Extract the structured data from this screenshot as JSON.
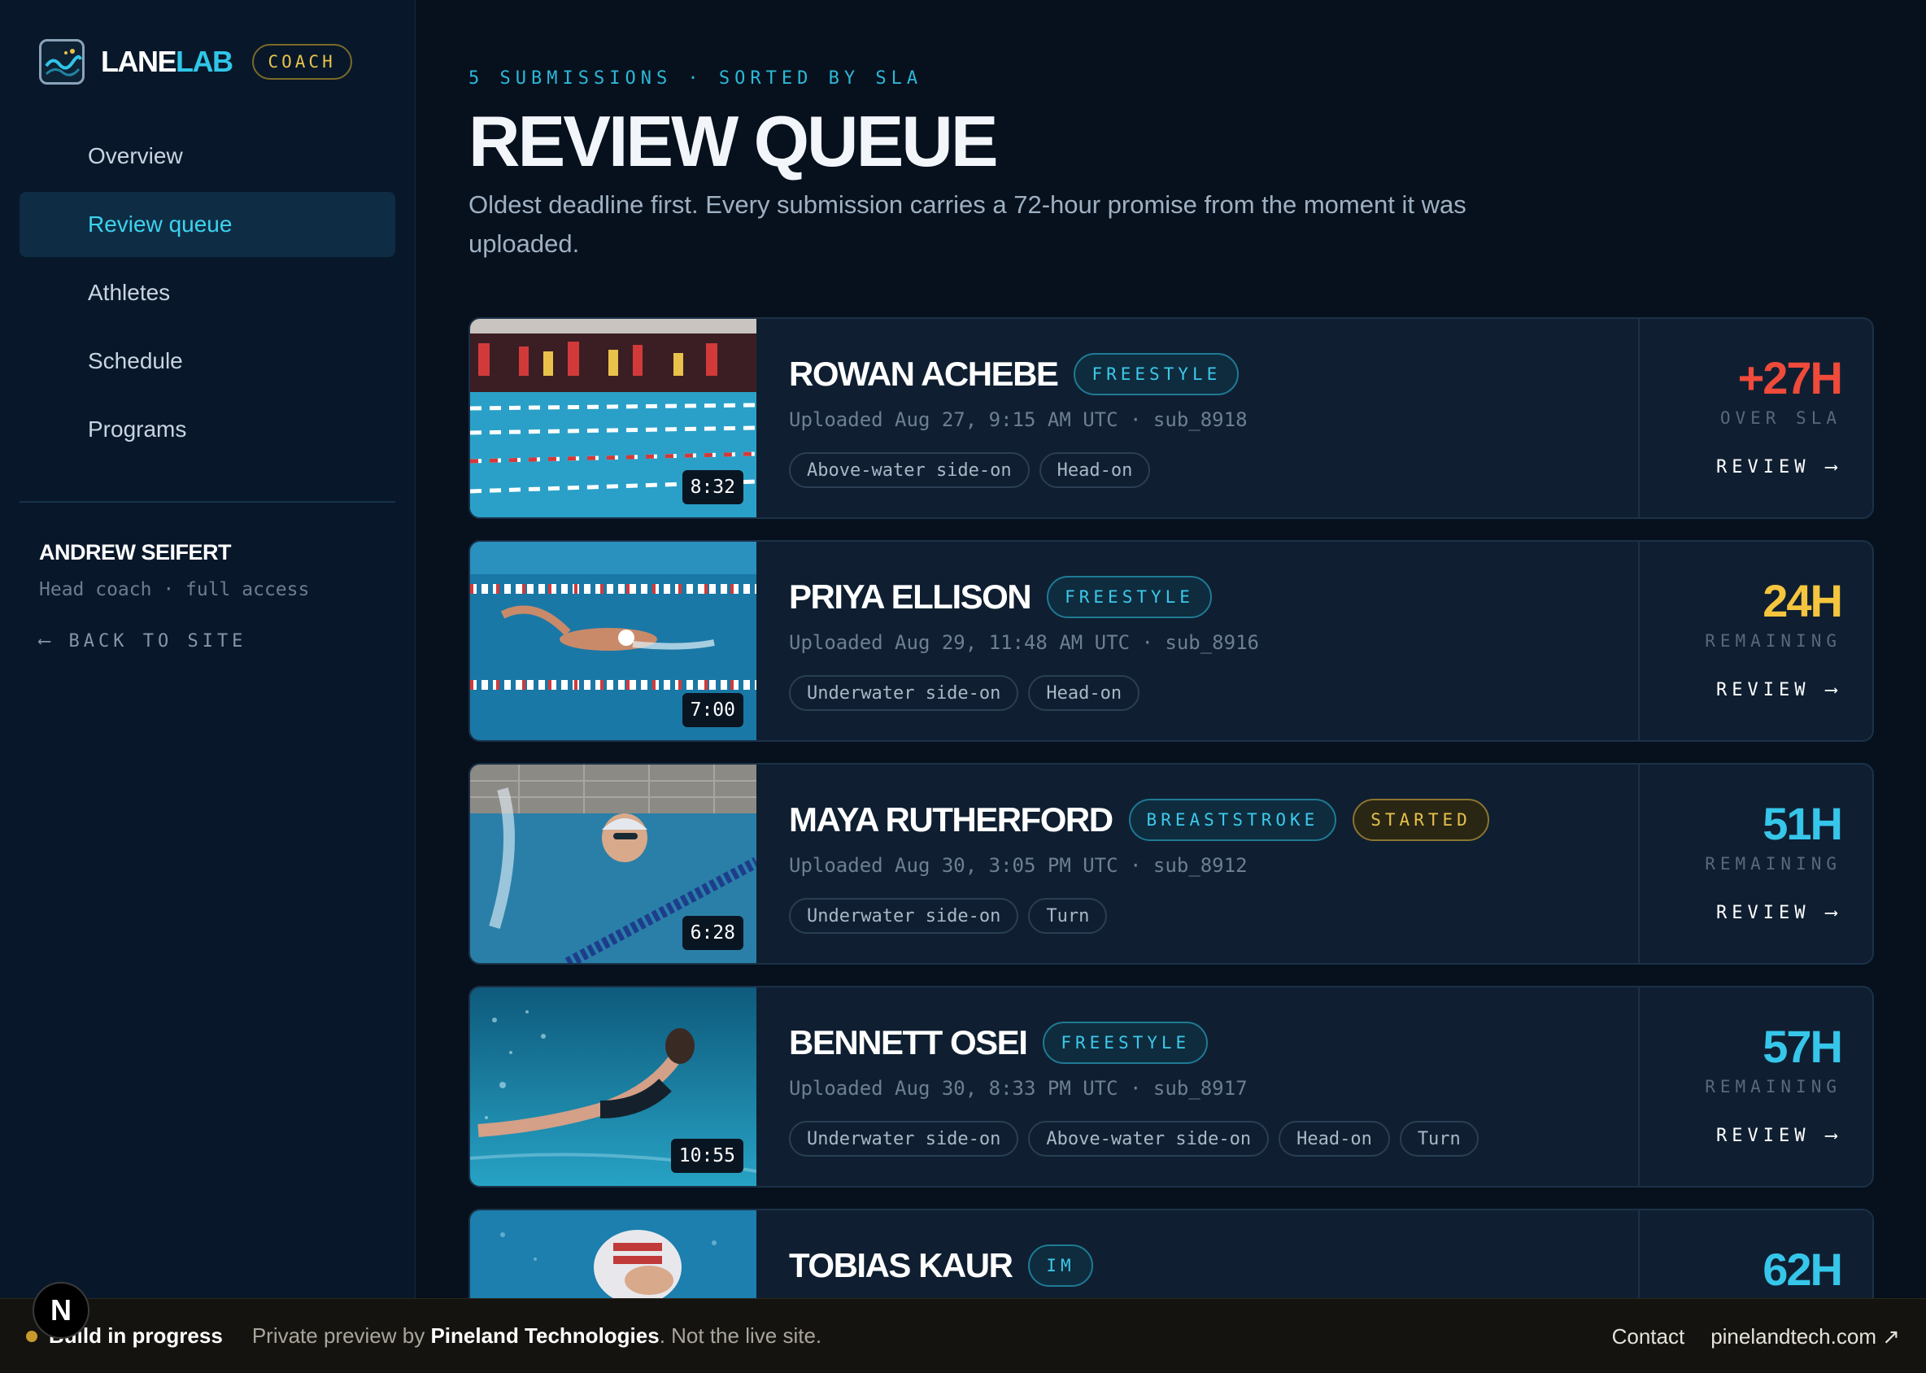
{
  "brand": {
    "name_part1": "LANE",
    "name_part2": "LAB",
    "role_badge": "COACH"
  },
  "nav": [
    {
      "label": "Overview",
      "active": false
    },
    {
      "label": "Review queue",
      "active": true
    },
    {
      "label": "Athletes",
      "active": false
    },
    {
      "label": "Schedule",
      "active": false
    },
    {
      "label": "Programs",
      "active": false
    }
  ],
  "user": {
    "name": "ANDREW SEIFERT",
    "role": "Head coach · full access",
    "back_link": "⟵  BACK TO SITE"
  },
  "header": {
    "eyebrow": "5 SUBMISSIONS · SORTED BY SLA",
    "title": "REVIEW QUEUE",
    "description": "Oldest deadline first. Every submission carries a 72-hour promise from the moment it was uploaded."
  },
  "submissions": [
    {
      "name": "ROWAN ACHEBE",
      "stroke": "FREESTYLE",
      "status": "",
      "meta": "Uploaded Aug 27, 9:15 AM UTC · sub_8918",
      "tags": [
        "Above-water side-on",
        "Head-on"
      ],
      "duration": "8:32",
      "sla_value": "+27H",
      "sla_label": "OVER SLA",
      "sla_color": "#ef4a3a",
      "review_label": "REVIEW ⟶"
    },
    {
      "name": "PRIYA ELLISON",
      "stroke": "FREESTYLE",
      "status": "",
      "meta": "Uploaded Aug 29, 11:48 AM UTC · sub_8916",
      "tags": [
        "Underwater side-on",
        "Head-on"
      ],
      "duration": "7:00",
      "sla_value": "24H",
      "sla_label": "REMAINING",
      "sla_color": "#f5c53e",
      "review_label": "REVIEW ⟶"
    },
    {
      "name": "MAYA RUTHERFORD",
      "stroke": "BREASTSTROKE",
      "status": "STARTED",
      "meta": "Uploaded Aug 30, 3:05 PM UTC · sub_8912",
      "tags": [
        "Underwater side-on",
        "Turn"
      ],
      "duration": "6:28",
      "sla_value": "51H",
      "sla_label": "REMAINING",
      "sla_color": "#36c6ea",
      "review_label": "REVIEW ⟶"
    },
    {
      "name": "BENNETT OSEI",
      "stroke": "FREESTYLE",
      "status": "",
      "meta": "Uploaded Aug 30, 8:33 PM UTC · sub_8917",
      "tags": [
        "Underwater side-on",
        "Above-water side-on",
        "Head-on",
        "Turn"
      ],
      "duration": "10:55",
      "sla_value": "57H",
      "sla_label": "REMAINING",
      "sla_color": "#36c6ea",
      "review_label": "REVIEW ⟶"
    },
    {
      "name": "TOBIAS KAUR",
      "stroke": "IM",
      "status": "",
      "meta": "",
      "tags": [],
      "duration": "",
      "sla_value": "62H",
      "sla_label": "",
      "sla_color": "#36c6ea",
      "review_label": ""
    }
  ],
  "footer": {
    "build_status": "Build in progress",
    "preview_prefix": "Private preview by ",
    "company": "Pineland Technologies",
    "preview_suffix": ". Not the live site.",
    "contact": "Contact",
    "site_link": "pinelandtech.com ↗",
    "n_badge": "N"
  }
}
